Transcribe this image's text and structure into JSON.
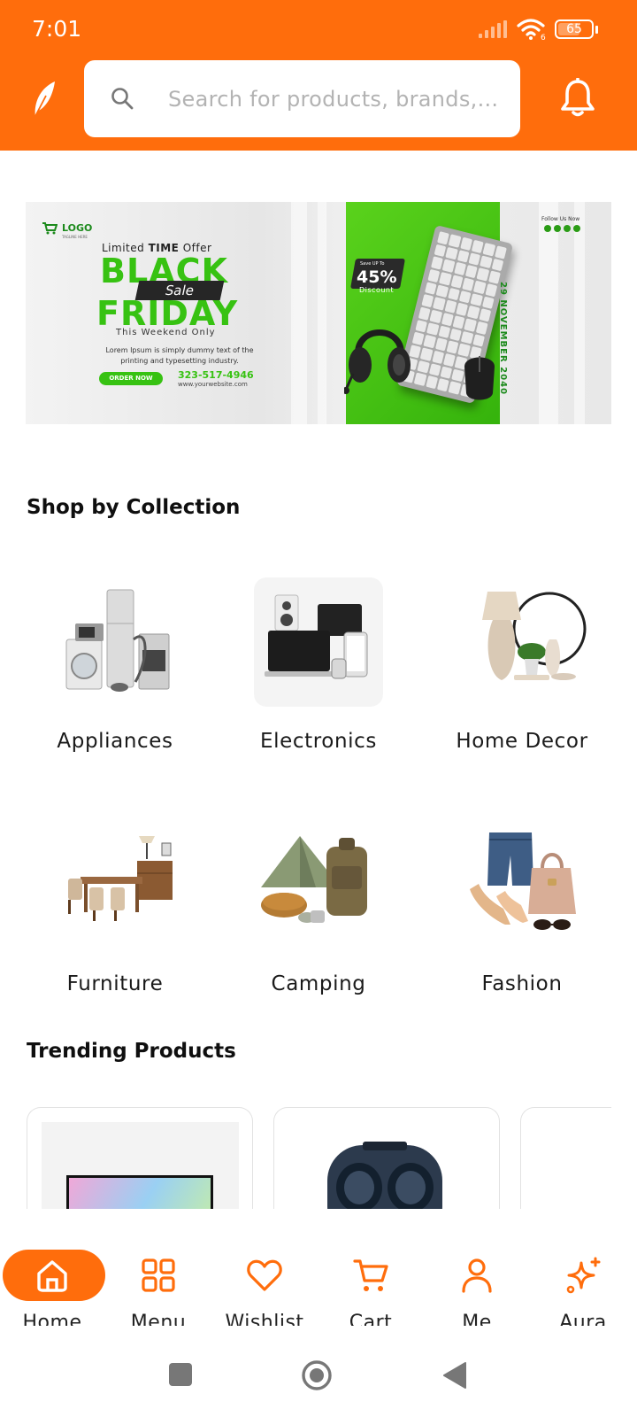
{
  "status_bar": {
    "time": "7:01",
    "signal_icon": "signal-bars-icon",
    "wifi_icon": "wifi-icon",
    "wifi_badge": "6",
    "battery_icon": "battery-icon",
    "battery_level": "65"
  },
  "header": {
    "logo_icon": "leaf-icon",
    "search": {
      "placeholder": "Search for products, brands,...",
      "value": "",
      "icon": "search-icon"
    },
    "notification_icon": "bell-icon",
    "accent_color": "#ff6d0c"
  },
  "banner": {
    "logo_text": "LOGO",
    "logo_tagline": "TAGLINE HERE",
    "limited_prefix": "Limited",
    "limited_bold": "TIME",
    "limited_suffix": "Offer",
    "headline_1": "BLACK",
    "sale": "Sale",
    "headline_2": "FRIDAY",
    "weekend": "This Weekend Only",
    "body": "Lorem Ipsum is simply dummy text of the printing and typesetting industry.",
    "cta": "ORDER NOW",
    "phone": "323-517-4946",
    "website": "www.yourwebsite.com",
    "save_label": "Save UP To",
    "discount_pct": "45%",
    "discount_word": "Discount",
    "follow": "Follow Us Now",
    "date": "29 NOVEMBER 2040",
    "green": "#37c212"
  },
  "collections": {
    "title": "Shop by Collection",
    "items": [
      {
        "label": "Appliances"
      },
      {
        "label": "Electronics"
      },
      {
        "label": "Home Decor"
      },
      {
        "label": "Furniture"
      },
      {
        "label": "Camping"
      },
      {
        "label": "Fashion"
      }
    ]
  },
  "trending": {
    "title": "Trending Products",
    "items": [
      {
        "icon": "monitor-product-image"
      },
      {
        "icon": "earbuds-product-image"
      },
      {
        "icon": "product-image"
      }
    ]
  },
  "bottom_nav": {
    "items": [
      {
        "label": "Home",
        "icon": "home-icon",
        "active": true
      },
      {
        "label": "Menu",
        "icon": "grid-icon",
        "active": false
      },
      {
        "label": "Wishlist",
        "icon": "heart-icon",
        "active": false
      },
      {
        "label": "Cart",
        "icon": "cart-icon",
        "active": false
      },
      {
        "label": "Me",
        "icon": "user-icon",
        "active": false
      },
      {
        "label": "Aura",
        "icon": "sparkle-icon",
        "active": false
      }
    ]
  },
  "system_nav": {
    "recents_icon": "square-icon",
    "home_icon": "circle-icon",
    "back_icon": "triangle-back-icon"
  }
}
